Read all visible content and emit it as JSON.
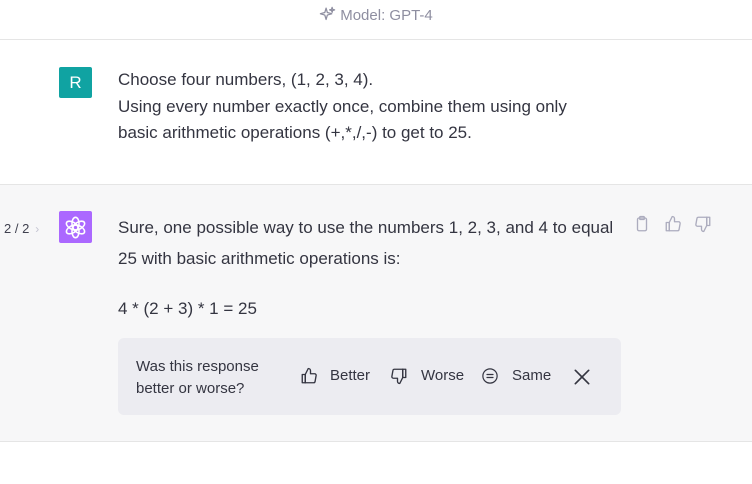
{
  "header": {
    "model_label": "Model: GPT-4"
  },
  "user_message": {
    "avatar_initial": "R",
    "lines": [
      "Choose four numbers, (1, 2, 3, 4).",
      "Using every number exactly once, combine them using only",
      "basic arithmetic operations (+,*,/,-) to get to 25."
    ]
  },
  "assistant_message": {
    "pager": "2 / 2",
    "pager_chevron": "›",
    "lines": [
      "Sure, one possible way to use the numbers 1, 2, 3, and 4 to equal",
      "25 with basic arithmetic operations is:"
    ],
    "equation": "4 * (2 + 3) * 1 = 25"
  },
  "feedback": {
    "question_lines": [
      "Was this response",
      "better or worse?"
    ],
    "better_label": "Better",
    "worse_label": "Worse",
    "same_label": "Same"
  },
  "colors": {
    "user_avatar": "#10a3a2",
    "assistant_avatar": "#ab68ff",
    "assistant_row_bg": "#f7f7f8",
    "feedback_bg": "#ececf1"
  }
}
